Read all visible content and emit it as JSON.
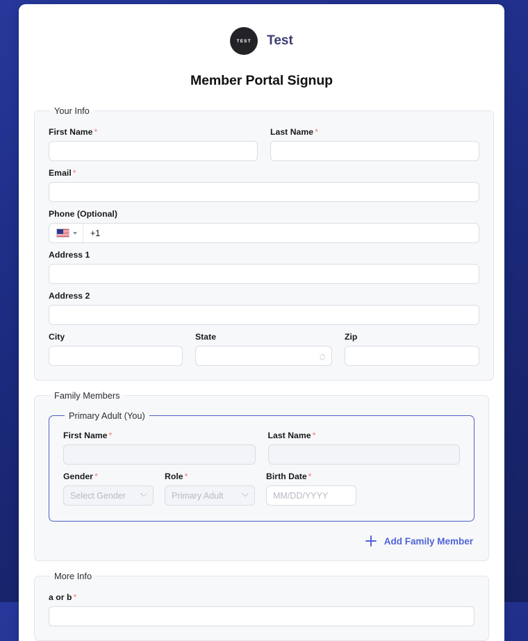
{
  "brand": {
    "logo_text": "TEST",
    "name": "Test"
  },
  "page_title": "Member Portal Signup",
  "sections": {
    "your_info": {
      "legend": "Your Info",
      "first_name": {
        "label": "First Name",
        "required": "*",
        "value": ""
      },
      "last_name": {
        "label": "Last Name",
        "required": "*",
        "value": ""
      },
      "email": {
        "label": "Email",
        "required": "*",
        "value": ""
      },
      "phone": {
        "label": "Phone (Optional)",
        "country": "United States",
        "dial_code": "+1"
      },
      "address1": {
        "label": "Address 1",
        "value": ""
      },
      "address2": {
        "label": "Address 2",
        "value": ""
      },
      "city": {
        "label": "City",
        "value": ""
      },
      "state": {
        "label": "State",
        "value": ""
      },
      "zip": {
        "label": "Zip",
        "value": ""
      }
    },
    "family_members": {
      "legend": "Family Members",
      "primary_adult": {
        "legend": "Primary Adult (You)",
        "first_name": {
          "label": "First Name",
          "required": "*",
          "value": ""
        },
        "last_name": {
          "label": "Last Name",
          "required": "*",
          "value": ""
        },
        "gender": {
          "label": "Gender",
          "required": "*",
          "placeholder": "Select Gender"
        },
        "role": {
          "label": "Role",
          "required": "*",
          "placeholder": "Primary Adult"
        },
        "birth_date": {
          "label": "Birth Date",
          "required": "*",
          "placeholder": "MM/DD/YYYY"
        }
      },
      "add_button": "Add Family Member"
    },
    "more_info": {
      "legend": "More Info",
      "field_a_or_b": {
        "label": "a or b",
        "required": "*"
      }
    }
  },
  "colors": {
    "page_background": "#1f2f8c",
    "accent": "#4f63d8",
    "brand_text": "#3b3b72",
    "required_marker": "#f07a6b",
    "subsection_border": "#4c5fc4"
  }
}
